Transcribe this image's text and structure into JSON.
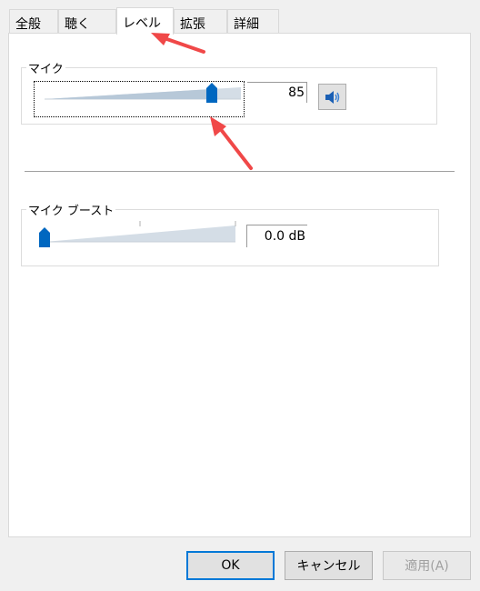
{
  "tabs": [
    {
      "label": "全般"
    },
    {
      "label": "聴く"
    },
    {
      "label": "レベル"
    },
    {
      "label": "拡張"
    },
    {
      "label": "詳細"
    }
  ],
  "selected_tab": "レベル",
  "mic": {
    "title": "マイク",
    "value": "85",
    "level": 0.85,
    "mute_button": "speaker-icon"
  },
  "boost": {
    "title": "マイク ブースト",
    "value": "0.0 dB",
    "level": 0
  },
  "buttons": {
    "ok": "OK",
    "cancel": "キャンセル",
    "apply": "適用(A)"
  },
  "colors": {
    "accent": "#0078d7",
    "arrow": "#f04848",
    "selection": "#cce8ff"
  }
}
